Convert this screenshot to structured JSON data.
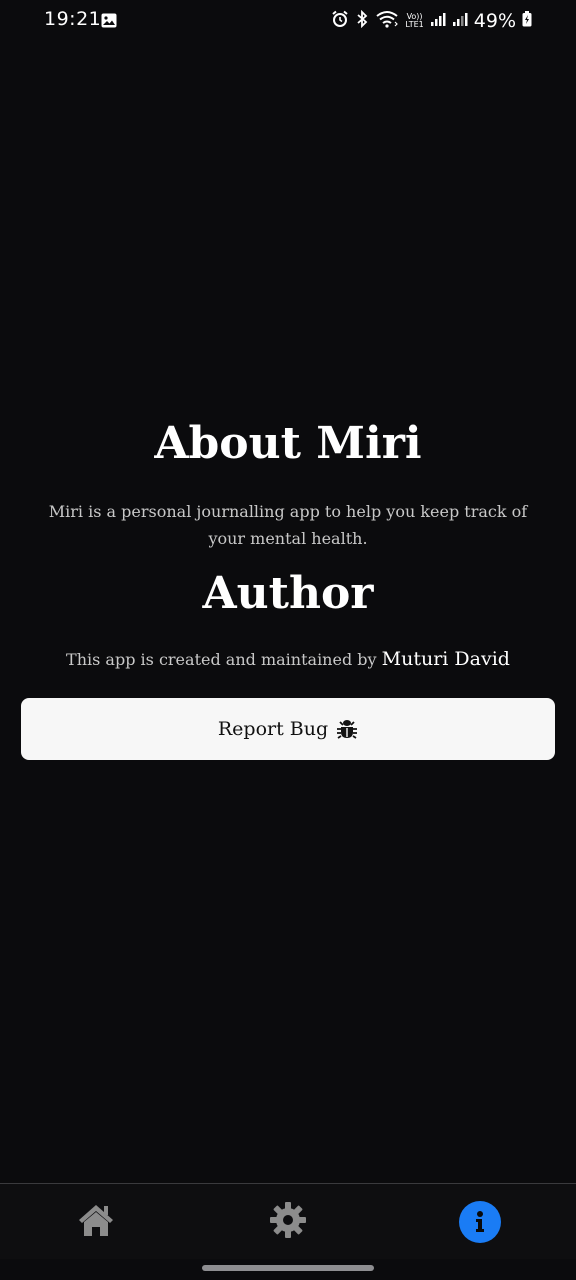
{
  "status_bar": {
    "time": "19:21",
    "battery_percent": "49%",
    "network_label_top": "Vo))",
    "network_label_bottom": "LTE1",
    "icons": [
      "gallery-icon",
      "alarm-icon",
      "bluetooth-icon",
      "wifi-icon",
      "volte-lte-icon",
      "signal-icon",
      "signal-icon",
      "battery-charging-icon"
    ]
  },
  "about": {
    "title": "About Miri",
    "description": "Miri is a personal journalling app to help you keep track of your mental health."
  },
  "author": {
    "title": "Author",
    "line_prefix": "This app is created and maintained by",
    "name": "Muturi David"
  },
  "report": {
    "label": "Report Bug",
    "icon": "bug-icon"
  },
  "bottom_nav": {
    "items": [
      {
        "name": "home",
        "icon": "home-icon",
        "active": false
      },
      {
        "name": "settings",
        "icon": "gear-icon",
        "active": false
      },
      {
        "name": "about",
        "icon": "info-icon",
        "active": true
      }
    ],
    "active_color": "#1a7cf5",
    "inactive_color": "#8c8c8c"
  },
  "colors": {
    "background": "#0b0b0d",
    "button_background": "#f7f7f7"
  }
}
